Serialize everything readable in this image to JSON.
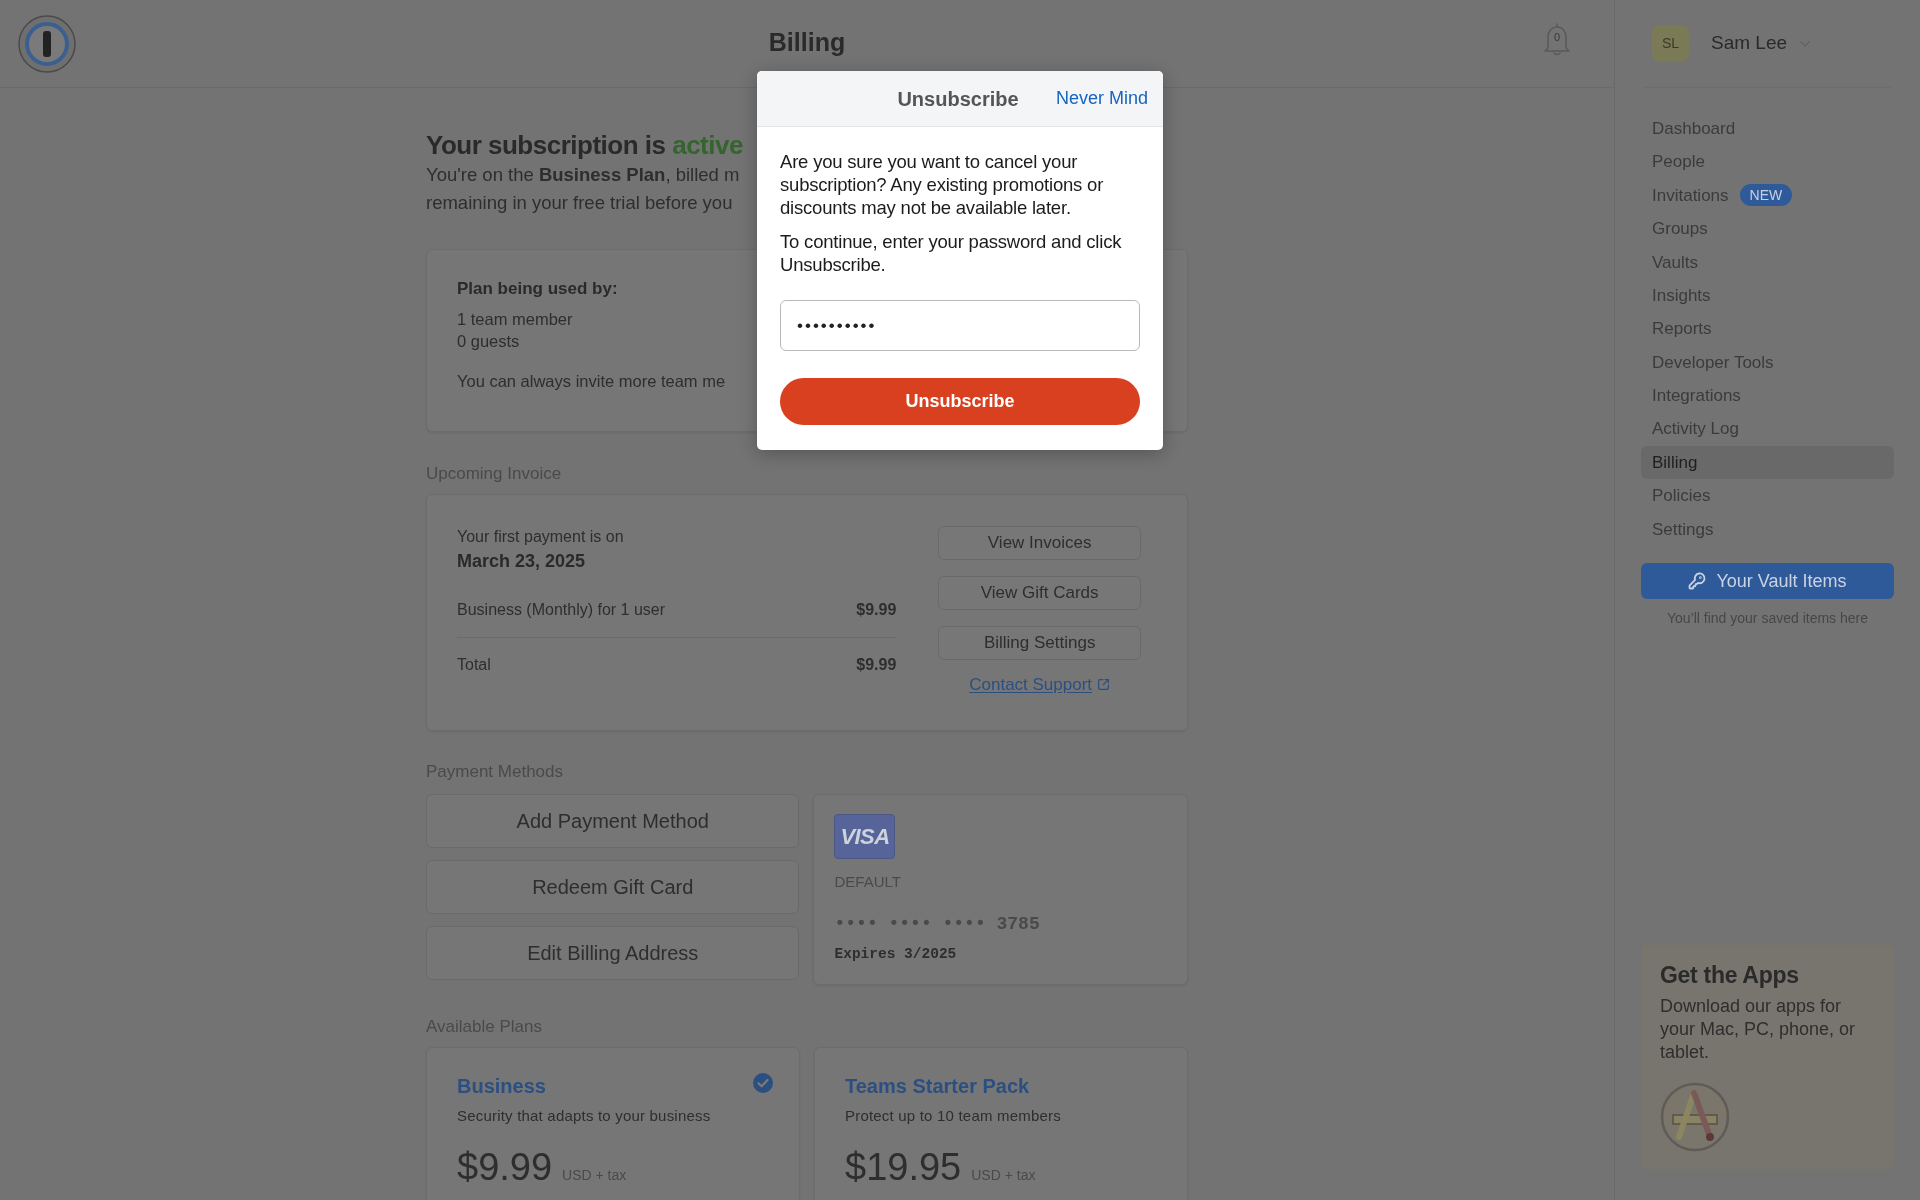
{
  "header": {
    "title": "Billing",
    "notifications": {
      "count": "0"
    }
  },
  "user": {
    "initials": "SL",
    "name": "Sam Lee"
  },
  "sidebar": {
    "items": [
      {
        "label": "Dashboard",
        "selected": false
      },
      {
        "label": "People",
        "selected": false
      },
      {
        "label": "Invitations",
        "selected": false,
        "badge": "NEW"
      },
      {
        "label": "Groups",
        "selected": false
      },
      {
        "label": "Vaults",
        "selected": false
      },
      {
        "label": "Insights",
        "selected": false
      },
      {
        "label": "Reports",
        "selected": false
      },
      {
        "label": "Developer Tools",
        "selected": false
      },
      {
        "label": "Integrations",
        "selected": false
      },
      {
        "label": "Activity Log",
        "selected": false
      },
      {
        "label": "Billing",
        "selected": true
      },
      {
        "label": "Policies",
        "selected": false
      },
      {
        "label": "Settings",
        "selected": false
      }
    ],
    "vault_button": "Your Vault Items",
    "vault_hint": "You’ll find your saved items here"
  },
  "apps_card": {
    "title": "Get the Apps",
    "text": "Download our apps for your Mac, PC, phone, or tablet."
  },
  "subscription": {
    "heading": "Your subscription is",
    "status": "active",
    "lines": [
      "You're on the **Business Plan**, billed m",
      "remaining in your free trial before you"
    ]
  },
  "plan_usage": {
    "title": "Plan being used by:",
    "lines": [
      "1 team member",
      "0 guests"
    ],
    "note": "You can always invite more team me"
  },
  "upcoming_invoice": {
    "label": "Upcoming Invoice",
    "first_payment_label": "Your first payment is on",
    "first_payment_date": "March 23, 2025",
    "lines": [
      {
        "description": "Business (Monthly) for 1 user",
        "amount": "$9.99"
      }
    ],
    "total": {
      "label": "Total",
      "amount": "$9.99"
    },
    "buttons": [
      "View Invoices",
      "View Gift Cards",
      "Billing Settings"
    ],
    "support_link": "Contact Support"
  },
  "payment_methods": {
    "label": "Payment Methods",
    "actions": [
      "Add Payment Method",
      "Redeem Gift Card",
      "Edit Billing Address"
    ],
    "card": {
      "brand": "VISA",
      "status": "DEFAULT",
      "number": "•••• •••• •••• 3785",
      "expires": "Expires 3/2025"
    }
  },
  "available_plans": {
    "label": "Available Plans",
    "plans": [
      {
        "name": "Business",
        "description": "Security that adapts to your business",
        "price": "$9.99",
        "price_note": "USD + tax",
        "selected": true
      },
      {
        "name": "Teams Starter Pack",
        "description": "Protect up to 10 team members",
        "price": "$19.95",
        "price_note": "USD + tax",
        "selected": false
      }
    ]
  },
  "dialog": {
    "title": "Unsubscribe",
    "dismiss": "Never Mind",
    "paragraphs": [
      "Are you sure you want to cancel your subscription? Any existing promotions or discounts may not be available later.",
      "To continue, enter your password and click Unsubscribe."
    ],
    "password": {
      "value": "••••••••••"
    },
    "submit": "Unsubscribe"
  }
}
